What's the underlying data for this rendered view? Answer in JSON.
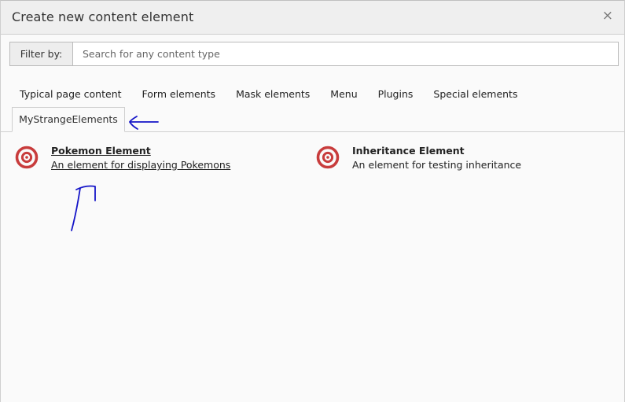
{
  "dialog": {
    "title": "Create new content element",
    "close_symbol": "×"
  },
  "filter": {
    "label": "Filter by:",
    "placeholder": "Search for any content type",
    "value": ""
  },
  "tabs": [
    {
      "label": "Typical page content",
      "active": false
    },
    {
      "label": "Form elements",
      "active": false
    },
    {
      "label": "Mask elements",
      "active": false
    },
    {
      "label": "Menu",
      "active": false
    },
    {
      "label": "Plugins",
      "active": false
    },
    {
      "label": "Special elements",
      "active": false
    },
    {
      "label": "MyStrangeElements",
      "active": true
    }
  ],
  "elements": [
    {
      "title": "Pokemon Element",
      "description": "An element for displaying Pokemons",
      "icon": "target-icon",
      "hovered": true
    },
    {
      "title": "Inheritance Element",
      "description": "An element for testing inheritance",
      "icon": "target-icon",
      "hovered": false
    }
  ],
  "colors": {
    "icon_red": "#c83c3c",
    "annotation_blue": "#1515c8"
  }
}
